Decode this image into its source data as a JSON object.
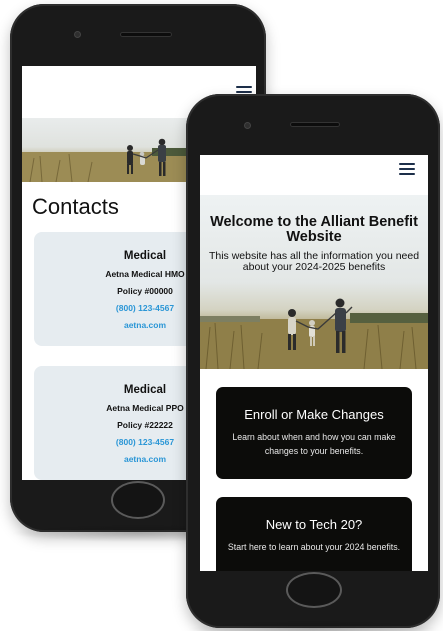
{
  "back_phone": {
    "contacts_heading": "Contacts",
    "cards": [
      {
        "title": "Medical",
        "plan": "Aetna Medical HMO",
        "policy": "Policy #00000",
        "phone": "(800) 123-4567",
        "website": "aetna.com"
      },
      {
        "title": "Medical",
        "plan": "Aetna Medical PPO",
        "policy": "Policy #22222",
        "phone": "(800) 123-4567",
        "website": "aetna.com"
      }
    ]
  },
  "front_phone": {
    "hero_title": "Welcome to the Alliant Benefit Website",
    "hero_subtitle": "This website has all the information you need about your 2024-2025 benefits",
    "cards": [
      {
        "title": "Enroll or Make Changes",
        "description": "Learn about when and how you can make changes to your benefits."
      },
      {
        "title": "New to Tech 20?",
        "description": "Start here to learn about your 2024 benefits."
      }
    ]
  },
  "colors": {
    "link_blue": "#2a96d6",
    "card_bg": "#e6ecf0",
    "dark_card_bg": "#0c0c0a",
    "nav_icon": "#1d2f4a"
  },
  "icons": {
    "menu": "hamburger-menu-icon"
  }
}
